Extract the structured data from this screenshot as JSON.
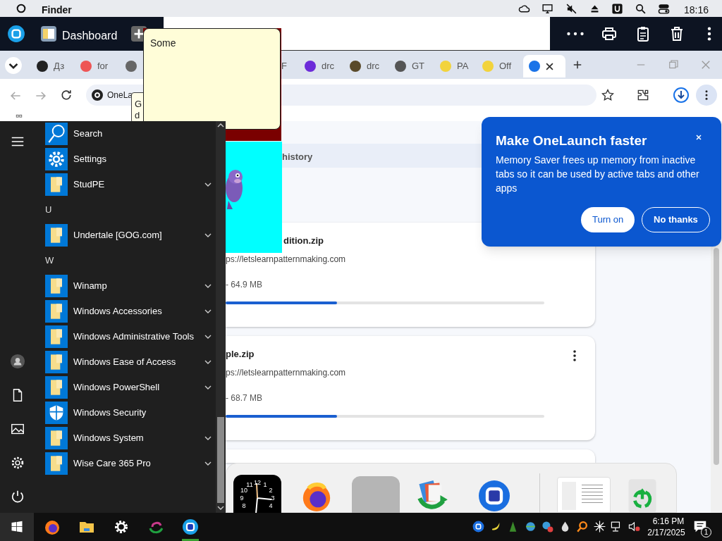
{
  "menubar": {
    "app": "Finder",
    "time": "18:16"
  },
  "dashboard": {
    "title": "Dashboard"
  },
  "tabs": [
    {
      "kind": "full",
      "label": "Дз",
      "selected": false
    },
    {
      "kind": "full",
      "label": "for",
      "selected": false
    },
    {
      "kind": "full",
      "selected": false
    },
    {
      "kind": "cut",
      "label": "F",
      "selected": false
    },
    {
      "kind": "full",
      "label": "drc",
      "selected": false
    },
    {
      "kind": "full",
      "label": "drc",
      "selected": false
    },
    {
      "kind": "full",
      "label": "GT",
      "selected": false
    },
    {
      "kind": "full",
      "label": "PA",
      "selected": false
    },
    {
      "kind": "full",
      "label": "Off",
      "selected": false
    },
    {
      "kind": "full",
      "selected": true
    }
  ],
  "address": "OneLa",
  "tooltip": [
    "G",
    "d"
  ],
  "note": {
    "text": "Some"
  },
  "downloads": {
    "heading": "history",
    "items": [
      {
        "name": "dition.zip",
        "source": "ps://letslearnpatternmaking.com",
        "size": "- 64.9 MB",
        "level": 0.35
      },
      {
        "name": "ple.zip",
        "source": "ps://letslearnpatternmaking.com",
        "size": "- 68.7 MB",
        "level": 0.35,
        "menu": true
      }
    ]
  },
  "bubble": {
    "title": "Make OneLaunch faster",
    "body": "Memory Saver frees up memory from inactive tabs so it can be used by active tabs and other apps",
    "buttons": [
      {
        "label": "Turn on",
        "kind": "primary"
      },
      {
        "label": "No thanks",
        "kind": "outline"
      }
    ]
  },
  "start_menu": {
    "items": [
      {
        "kind": "search",
        "label": "Search",
        "expandable": false
      },
      {
        "kind": "settings",
        "label": "Settings",
        "expandable": false
      },
      {
        "kind": "folder",
        "label": "StudPE",
        "expandable": true
      },
      {
        "kind": "header",
        "label": "U"
      },
      {
        "kind": "folder",
        "label": "Undertale [GOG.com]",
        "expandable": true
      },
      {
        "kind": "header",
        "label": "W"
      },
      {
        "kind": "folder",
        "label": "Winamp",
        "expandable": true
      },
      {
        "kind": "folder",
        "label": "Windows Accessories",
        "expandable": true
      },
      {
        "kind": "folder",
        "label": "Windows Administrative Tools",
        "expandable": true
      },
      {
        "kind": "folder",
        "label": "Windows Ease of Access",
        "expandable": true
      },
      {
        "kind": "folder",
        "label": "Windows PowerShell",
        "expandable": true
      },
      {
        "kind": "security",
        "label": "Windows Security",
        "expandable": false
      },
      {
        "kind": "folder",
        "label": "Windows System",
        "expandable": true
      },
      {
        "kind": "folder",
        "label": "Wise Care 365 Pro",
        "expandable": true
      }
    ]
  },
  "dock": {
    "clock_numerals": [
      "11",
      "12",
      "1",
      "10",
      "2",
      "9",
      "3",
      "8",
      "4"
    ]
  },
  "taskbar": {
    "time": "6:16 PM",
    "date": "2/17/2025",
    "notifications": "1"
  }
}
